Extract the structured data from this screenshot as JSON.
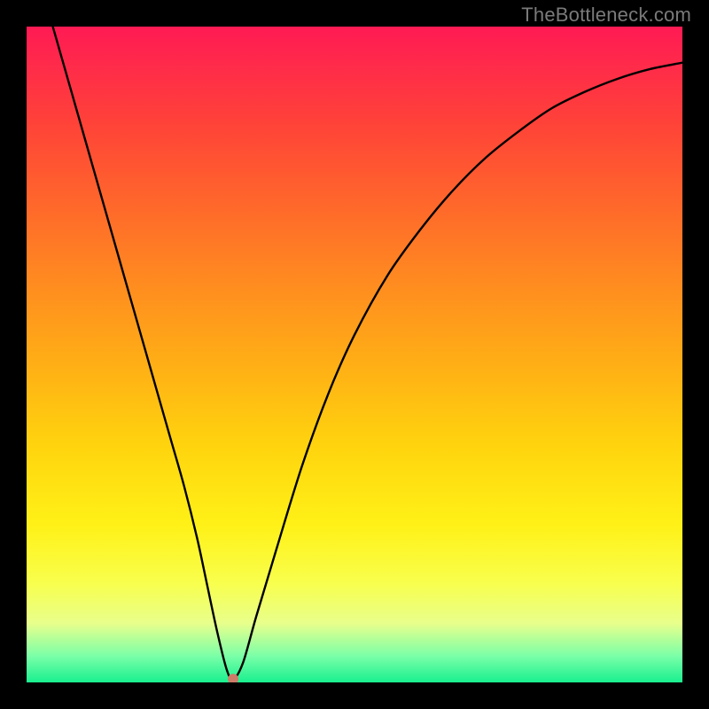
{
  "attribution": "TheBottleneck.com",
  "chart_data": {
    "type": "line",
    "title": "",
    "xlabel": "",
    "ylabel": "",
    "xlim": [
      0,
      100
    ],
    "ylim": [
      0,
      100
    ],
    "series": [
      {
        "name": "bottleneck-curve",
        "x": [
          4,
          6,
          8,
          10,
          12,
          14,
          16,
          18,
          20,
          22,
          24,
          26,
          27.5,
          29,
          30.5,
          31.5,
          33,
          35,
          38,
          42,
          46,
          50,
          55,
          60,
          65,
          70,
          75,
          80,
          85,
          90,
          95,
          100
        ],
        "y": [
          100,
          93,
          86,
          79,
          72,
          65,
          58,
          51,
          44,
          37,
          30,
          22,
          15,
          8,
          2,
          0.5,
          3,
          10,
          20,
          33,
          44,
          53,
          62,
          69,
          75,
          80,
          84,
          87.5,
          90,
          92,
          93.5,
          94.5
        ]
      }
    ],
    "min_point": {
      "x": 31.5,
      "y": 0.5
    },
    "colors": {
      "curve": "#000000",
      "dot": "#cf7b69",
      "bg_top": "#ff1a53",
      "bg_bottom": "#19f08f"
    }
  }
}
